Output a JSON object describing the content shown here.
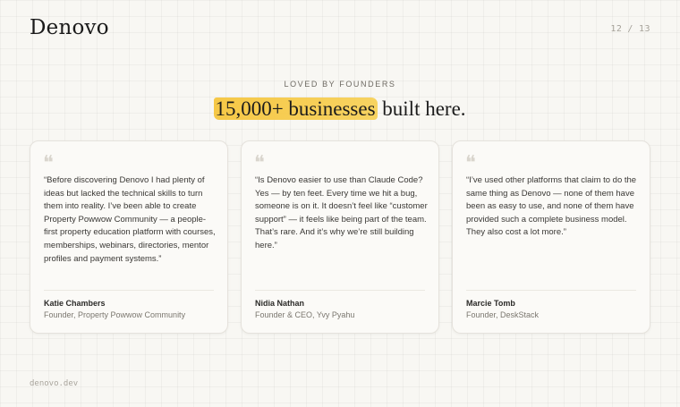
{
  "brand": {
    "name": "Denovo"
  },
  "pager": {
    "current": "12",
    "separator": "/",
    "total": "13"
  },
  "section": {
    "eyebrow": "LOVED BY FOUNDERS",
    "headline_highlight": "15,000+ businesses",
    "headline_rest": " built here."
  },
  "testimonials": [
    {
      "quote": "“Before discovering Denovo I had plenty of ideas but lacked the technical skills to turn them into reality. I’ve been able to create Property Powwow Community — a people-first property education platform with courses, memberships, webinars, directories, mentor profiles and payment systems.”",
      "name": "Katie Chambers",
      "role": "Founder, Property Powwow Community"
    },
    {
      "quote": "“Is Denovo easier to use than Claude Code? Yes — by ten feet. Every time we hit a bug, someone is on it. It doesn’t feel like “customer support” — it feels like being part of the team. That’s rare. And it’s why we’re still building here.”",
      "name": "Nidia Nathan",
      "role": "Founder & CEO, Yvy Pyahu"
    },
    {
      "quote": "“I’ve used other platforms that claim to do the same thing as Denovo — none of them have been as easy to use, and none of them have provided such a complete business model. They also cost a lot more.”",
      "name": "Marcie Tomb",
      "role": "Founder, DeskStack"
    }
  ],
  "footer": {
    "url": "denovo.dev"
  },
  "colors": {
    "highlight": "#f6c438",
    "background": "#f8f7f3"
  }
}
